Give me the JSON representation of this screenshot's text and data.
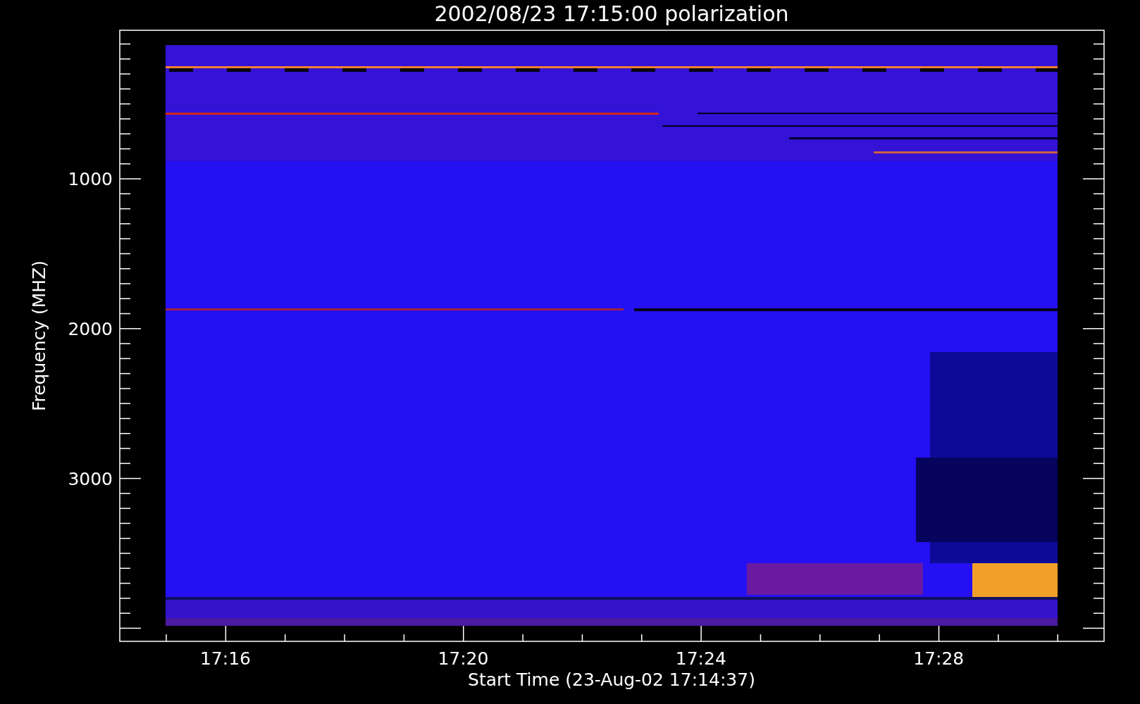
{
  "title": "2002/08/23 17:15:00 polarization",
  "ylabel": "Frequency (MHZ)",
  "xlabel": "Start Time (23-Aug-02 17:14:37)",
  "yticks": [
    "1000",
    "2000",
    "3000"
  ],
  "xticks": [
    "17:16",
    "17:20",
    "17:24",
    "17:28"
  ]
}
